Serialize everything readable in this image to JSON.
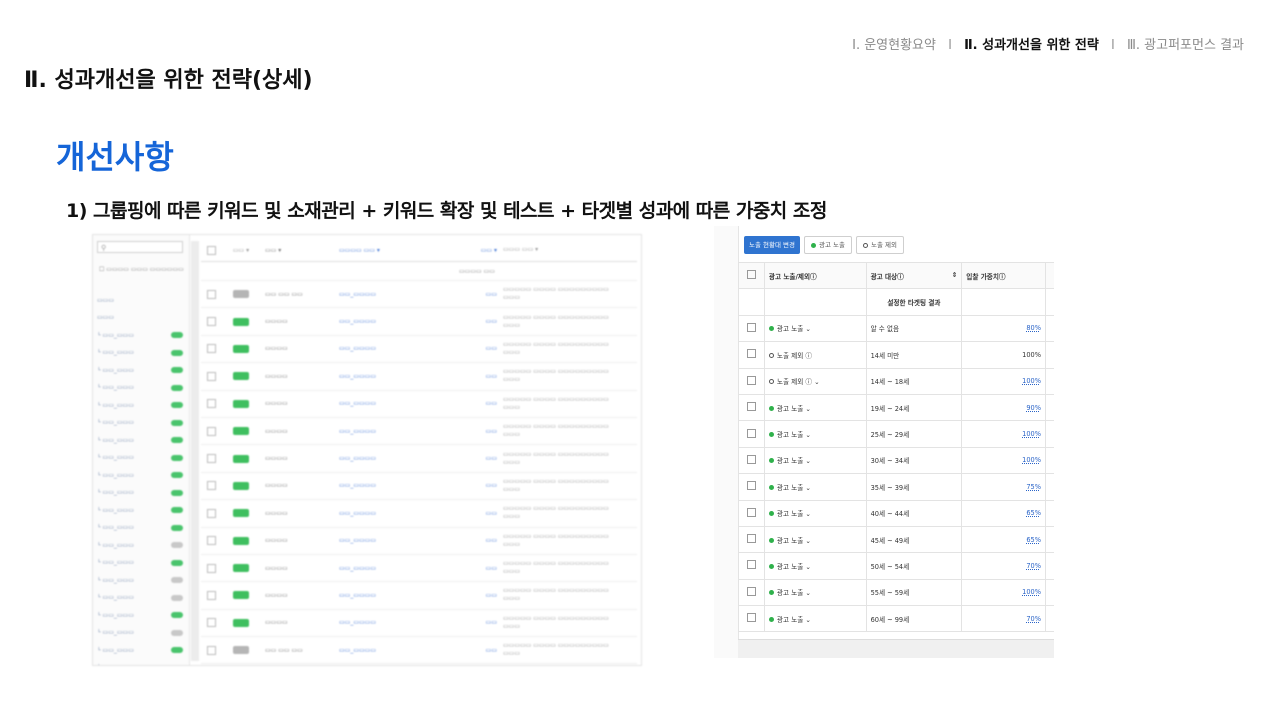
{
  "nav": {
    "item1": "Ⅰ. 운영현황요약",
    "item2": "Ⅱ. 성과개선을 위한 전략",
    "item3": "Ⅲ. 광고퍼포먼스 결과",
    "sep": "Ι"
  },
  "page_title": "Ⅱ. 성과개선을 위한 전략(상세)",
  "section_title": "개선사항",
  "subtitle": "1) 그룹핑에 따른 키워드 및 소재관리 + 키워드 확장 및 테스트 + 타겟별 성과에 따른 가중치 조정",
  "right_panel": {
    "toolbar": {
      "change_button": "노출 현황대 변경",
      "show_button": "광고 노출",
      "hide_button": "노출 제외"
    },
    "columns": {
      "status": "광고 노출/제외ⓘ",
      "target": "광고 대상ⓘ",
      "bid_weight": "입찰 가중치ⓘ"
    },
    "subheader": "설정한 타겟팅 결과",
    "rows": [
      {
        "status": "광고 노출 ⌄",
        "shown": true,
        "target": "알 수 없음",
        "weight": "80%"
      },
      {
        "status": "노출 제외 ⓘ",
        "shown": false,
        "target": "14세 미만",
        "weight": "100%"
      },
      {
        "status": "노출 제외 ⓘ ⌄",
        "shown": false,
        "target": "14세 ~ 18세",
        "weight": "100%"
      },
      {
        "status": "광고 노출 ⌄",
        "shown": true,
        "target": "19세 ~ 24세",
        "weight": "90%"
      },
      {
        "status": "광고 노출 ⌄",
        "shown": true,
        "target": "25세 ~ 29세",
        "weight": "100%"
      },
      {
        "status": "광고 노출 ⌄",
        "shown": true,
        "target": "30세 ~ 34세",
        "weight": "100%"
      },
      {
        "status": "광고 노출 ⌄",
        "shown": true,
        "target": "35세 ~ 39세",
        "weight": "75%"
      },
      {
        "status": "광고 노출 ⌄",
        "shown": true,
        "target": "40세 ~ 44세",
        "weight": "65%"
      },
      {
        "status": "광고 노출 ⌄",
        "shown": true,
        "target": "45세 ~ 49세",
        "weight": "65%"
      },
      {
        "status": "광고 노출 ⌄",
        "shown": true,
        "target": "50세 ~ 54세",
        "weight": "70%"
      },
      {
        "status": "광고 노출 ⌄",
        "shown": true,
        "target": "55세 ~ 59세",
        "weight": "100%"
      },
      {
        "status": "광고 노출 ⌄",
        "shown": true,
        "target": "60세 ~ 99세",
        "weight": "70%"
      }
    ]
  }
}
